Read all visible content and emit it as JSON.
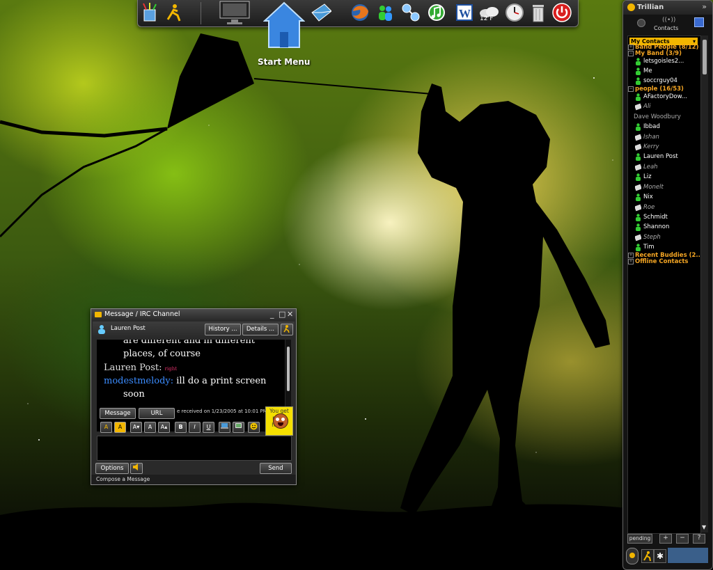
{
  "dock": {
    "start_label": "Start Menu",
    "weather_temp": "12 F",
    "icons": [
      "pencil-cup-icon",
      "aim-running-man-icon",
      "monitor-icon",
      "home-icon",
      "mail-envelope-icon",
      "firefox-icon",
      "msn-messenger-icon",
      "music-note-icon",
      "word-icon",
      "weather-cloud-icon",
      "clock-icon",
      "recycle-bin-icon",
      "power-icon"
    ]
  },
  "trillian": {
    "title": "Trillian",
    "tab_label": "Contacts",
    "dropdown_label": "My Contacts",
    "groups": [
      {
        "label": "Band People (8/12)"
      },
      {
        "label": "My Band (3/9)"
      },
      {
        "label": "people (16/53)"
      },
      {
        "label": "Recent Buddies (2..."
      },
      {
        "label": "Offline Contacts"
      }
    ],
    "contacts": [
      {
        "name": "letsgoisles2...",
        "status": "online"
      },
      {
        "name": "Me",
        "status": "online"
      },
      {
        "name": "soccrguy04",
        "status": "online"
      },
      {
        "name": "AFactoryDow...",
        "status": "online"
      },
      {
        "name": "Ali",
        "status": "away"
      },
      {
        "name": "Dave Woodbury",
        "status": "plain"
      },
      {
        "name": "Ibbad",
        "status": "online"
      },
      {
        "name": "Ishan",
        "status": "away"
      },
      {
        "name": "Kerry",
        "status": "away"
      },
      {
        "name": "Lauren Post",
        "status": "online"
      },
      {
        "name": "Leah",
        "status": "away"
      },
      {
        "name": "Liz",
        "status": "online"
      },
      {
        "name": "Monelt",
        "status": "away"
      },
      {
        "name": "Nix",
        "status": "online"
      },
      {
        "name": "Roe",
        "status": "away"
      },
      {
        "name": "Schmidt",
        "status": "online"
      },
      {
        "name": "Shannon",
        "status": "online"
      },
      {
        "name": "Steph",
        "status": "away"
      },
      {
        "name": "Tim",
        "status": "online"
      }
    ],
    "pending_label": "pending",
    "btn_add": "+",
    "btn_remove": "−",
    "btn_more": "?"
  },
  "message_window": {
    "title": "Message / IRC Channel",
    "contact_name": "Lauren Post",
    "history_label": "History ...",
    "details_label": "Details ...",
    "chat": [
      {
        "text": "are different and in different",
        "color": "#ffffff"
      },
      {
        "text": "places, of course",
        "color": "#ffffff"
      },
      {
        "speaker": "Lauren Post:",
        "text": "right",
        "speaker_color": "#e0e0e0",
        "text_color": "#e0306a"
      },
      {
        "speaker": "modestmelody:",
        "text": "ill do a print screen",
        "speaker_color": "#3b8cff",
        "text_color": "#ffffff"
      },
      {
        "text": "soon",
        "color": "#ffffff"
      }
    ],
    "message_tab": "Message",
    "url_tab": "URL",
    "received_text": "e received on 1/23/2005 at 10:01 PM",
    "emote_text": "You get more horny",
    "format_buttons": [
      "A",
      "A",
      "A▾",
      "A",
      "A▴",
      "B",
      "I",
      "U"
    ],
    "options_label": "Options",
    "send_label": "Send",
    "compose_label": "Compose a Message"
  },
  "colors": {
    "trillian_accent": "#f2b600",
    "group_label": "#f5a623",
    "chat_speaker_self": "#3b8cff",
    "chat_pink": "#e0306a"
  }
}
